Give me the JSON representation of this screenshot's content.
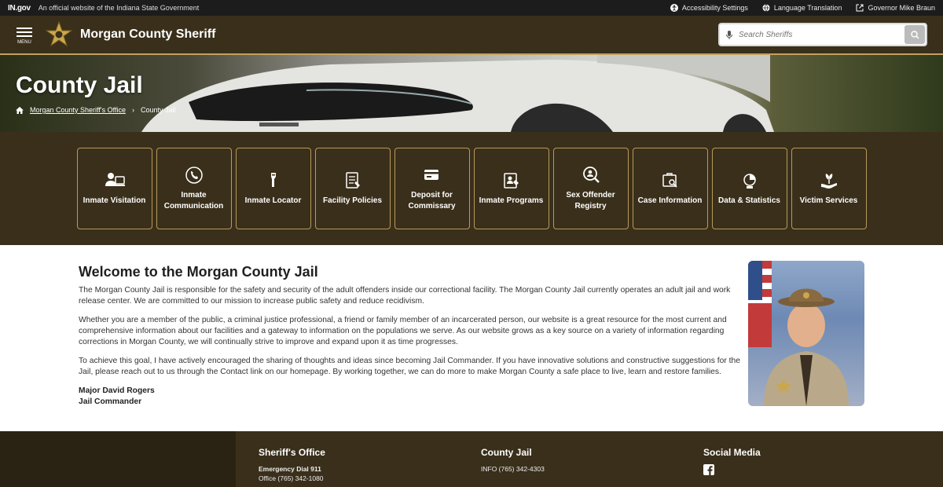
{
  "topbar": {
    "logo": "IN.gov",
    "official_text": "An official website of the Indiana State Government",
    "links": [
      {
        "label": "Accessibility Settings",
        "icon": "accessibility-icon"
      },
      {
        "label": "Language Translation",
        "icon": "globe-icon"
      },
      {
        "label": "Governor Mike Braun",
        "icon": "external-link-icon"
      }
    ]
  },
  "header": {
    "menu_label": "MENU",
    "title": "Morgan County Sheriff",
    "search_placeholder": "Search Sheriffs"
  },
  "hero": {
    "title": "County Jail",
    "breadcrumb": [
      "Morgan County Sheriff's Office",
      "County Jail"
    ]
  },
  "tiles": [
    {
      "label": "Inmate Visitation",
      "icon": "visitation-icon"
    },
    {
      "label": "Inmate Communication",
      "icon": "phone-communication-icon"
    },
    {
      "label": "Inmate Locator",
      "icon": "locator-icon"
    },
    {
      "label": "Facility Policies",
      "icon": "policies-icon"
    },
    {
      "label": "Deposit for Commissary",
      "icon": "credit-card-icon"
    },
    {
      "label": "Inmate Programs",
      "icon": "programs-icon"
    },
    {
      "label": "Sex Offender Registry",
      "icon": "search-person-icon"
    },
    {
      "label": "Case Information",
      "icon": "case-search-icon"
    },
    {
      "label": "Data & Statistics",
      "icon": "statistics-icon"
    },
    {
      "label": "Victim Services",
      "icon": "victim-services-icon"
    }
  ],
  "main": {
    "heading": "Welcome to the Morgan County Jail",
    "paragraphs": [
      "The Morgan County Jail is responsible for the safety and security of the adult offenders inside our correctional facility. The Morgan County Jail currently operates an adult jail and work release center. We are committed to our mission to increase public safety and reduce recidivism.",
      "Whether you are a member of the public, a criminal justice professional, a friend or family member of an incarcerated person, our website is a great resource for the most current and comprehensive information about our facilities and a gateway to information on the populations we serve. As our website grows as a key source on a variety of information regarding corrections in Morgan County, we will continually strive to improve and expand upon it as time progresses.",
      "To achieve this goal, I have actively encouraged the sharing of thoughts and ideas since becoming Jail Commander. If you have innovative solutions and constructive suggestions for the Jail, please reach out to us through the Contact link on our homepage. By working together, we can do more to make Morgan County a safe place to live, learn and restore families."
    ],
    "signature_name": "Major David Rogers",
    "signature_title": "Jail Commander"
  },
  "footer": {
    "cols": [
      {
        "title": "Sheriff's Office",
        "line1_bold": "Emergency Dial 911",
        "line2": "Office (765) 342-1080"
      },
      {
        "title": "County Jail",
        "line1": "INFO (765) 342-4303"
      },
      {
        "title": "Social Media",
        "icon": "facebook-icon"
      }
    ]
  },
  "colors": {
    "brown": "#3a2f1b",
    "gold": "#c1a15c"
  }
}
